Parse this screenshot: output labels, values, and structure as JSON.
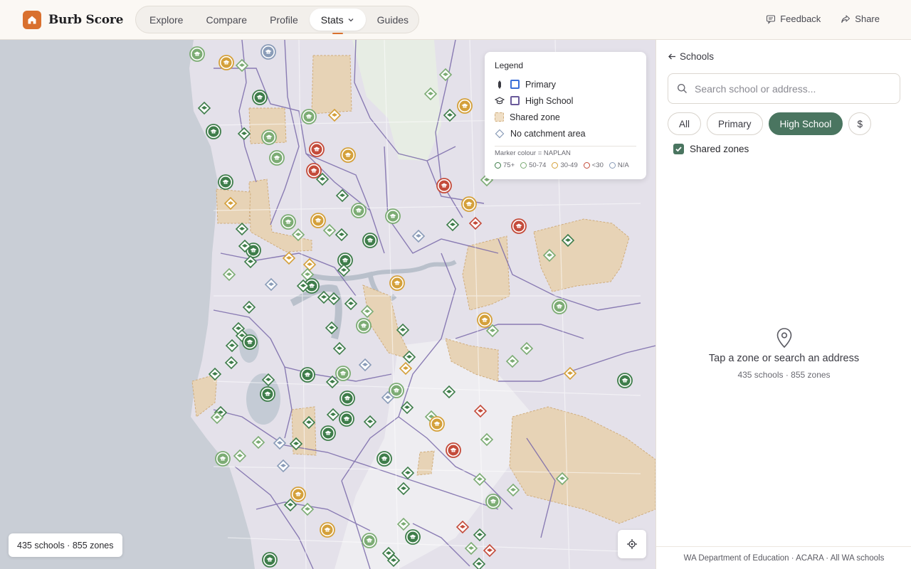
{
  "brand": {
    "name": "Burb Score",
    "logo_icon": "home-icon",
    "accent": "#d9702e"
  },
  "nav": {
    "items": [
      {
        "label": "Explore"
      },
      {
        "label": "Compare"
      },
      {
        "label": "Profile"
      },
      {
        "label": "Stats",
        "active": true,
        "has_caret": true
      },
      {
        "label": "Guides"
      }
    ]
  },
  "top_actions": {
    "feedback": "Feedback",
    "share": "Share"
  },
  "legend": {
    "title": "Legend",
    "items": [
      {
        "label": "Primary",
        "icon": "primary-marker-icon",
        "color": "#3b6fd8"
      },
      {
        "label": "High School",
        "icon": "graduation-cap-icon",
        "color": "#6a5a9a"
      },
      {
        "label": "Shared zone",
        "color": "#e7c9a0"
      },
      {
        "label": "No catchment area",
        "icon": "diamond-icon"
      }
    ],
    "note": "Marker colour = NAPLAN",
    "scale": [
      {
        "label": "75+",
        "color": "#3e7d4a"
      },
      {
        "label": "50-74",
        "color": "#7cac74"
      },
      {
        "label": "30-49",
        "color": "#d4a03a"
      },
      {
        "label": "<30",
        "color": "#c44b3a"
      },
      {
        "label": "N/A",
        "color": "#8a9cb8"
      }
    ]
  },
  "map": {
    "count_label": "435 schools · 855 zones"
  },
  "panel": {
    "back_label": "Schools",
    "search_placeholder": "Search school or address...",
    "filters": [
      {
        "label": "All"
      },
      {
        "label": "Primary"
      },
      {
        "label": "High School",
        "active": true
      },
      {
        "label": "$"
      }
    ],
    "shared_zones_label": "Shared zones",
    "shared_zones_checked": true,
    "empty_title": "Tap a zone or search an address",
    "empty_subtitle": "435 schools · 855 zones",
    "footer": "WA Department of Education · ACARA · All WA schools"
  }
}
